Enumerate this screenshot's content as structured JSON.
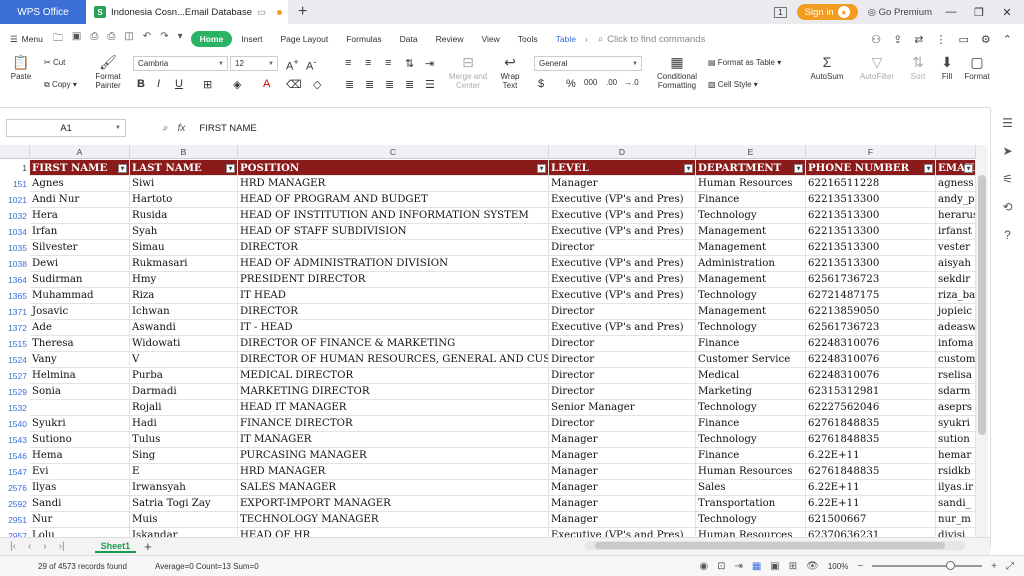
{
  "titlebar": {
    "app": "WPS Office",
    "doc_tab": "Indonesia Cosn...Email Database",
    "signin": "Sign in",
    "premium": "Go Premium",
    "page_counter": "1"
  },
  "menu": {
    "menu_label": "Menu",
    "tabs": [
      "Home",
      "Insert",
      "Page Layout",
      "Formulas",
      "Data",
      "Review",
      "View",
      "Tools",
      "Table"
    ],
    "search_placeholder": "Click to find commands"
  },
  "ribbon": {
    "paste": "Paste",
    "cut": "Cut",
    "copy": "Copy",
    "format_painter_1": "Format",
    "format_painter_2": "Painter",
    "font": "Cambria",
    "size": "12",
    "merge_1": "Merge and",
    "merge_2": "Center",
    "wrap_1": "Wrap",
    "wrap_2": "Text",
    "number_format": "General",
    "cond_1": "Conditional",
    "cond_2": "Formatting",
    "format_as_table": "Format as Table",
    "cell_style": "Cell Style",
    "autosum": "AutoSum",
    "autofilter": "AutoFilter",
    "sort": "Sort",
    "fill": "Fill",
    "format": "Format"
  },
  "formula": {
    "name_box": "A1",
    "value": "FIRST NAME"
  },
  "columns": [
    "A",
    "B",
    "C",
    "D",
    "E",
    "F",
    ""
  ],
  "header_row": {
    "num": "1",
    "cells": [
      "FIRST NAME",
      "LAST NAME",
      "POSITION",
      "LEVEL",
      "DEPARTMENT",
      "PHONE NUMBER",
      "EMAIL"
    ]
  },
  "rows": [
    {
      "num": "151",
      "cells": [
        "Agnes",
        "Siwi",
        "HRD MANAGER",
        "Manager",
        "Human Resources",
        "62216511228",
        "agness"
      ]
    },
    {
      "num": "1021",
      "cells": [
        "Andi Nur",
        "Hartoto",
        "HEAD OF PROGRAM AND BUDGET",
        "Executive (VP's and Pres)",
        "Finance",
        "62213513300",
        "andy_p"
      ]
    },
    {
      "num": "1032",
      "cells": [
        "Hera",
        "Rusida",
        "HEAD OF INSTITUTION AND INFORMATION SYSTEM",
        "Executive (VP's and Pres)",
        "Technology",
        "62213513300",
        "herarus"
      ]
    },
    {
      "num": "1034",
      "cells": [
        "Irfan",
        "Syah",
        "HEAD OF STAFF SUBDIVISION",
        "Executive (VP's and Pres)",
        "Management",
        "62213513300",
        "irfanst"
      ]
    },
    {
      "num": "1035",
      "cells": [
        "Silvester",
        "Simau",
        "DIRECTOR",
        "Director",
        "Management",
        "62213513300",
        "vester"
      ]
    },
    {
      "num": "1038",
      "cells": [
        "Dewi",
        "Rukmasari",
        "HEAD OF ADMINISTRATION DIVISION",
        "Executive (VP's and Pres)",
        "Administration",
        "62213513300",
        "aisyah"
      ]
    },
    {
      "num": "1364",
      "cells": [
        "Sudirman",
        "Hmy",
        "PRESIDENT DIRECTOR",
        "Executive (VP's and Pres)",
        "Management",
        "62561736723",
        "sekdir"
      ]
    },
    {
      "num": "1365",
      "cells": [
        "Muhammad",
        "Riza",
        "IT HEAD",
        "Executive (VP's and Pres)",
        "Technology",
        "62721487175",
        "riza_ba"
      ]
    },
    {
      "num": "1371",
      "cells": [
        "Josavic",
        "Ichwan",
        "DIRECTOR",
        "Director",
        "Management",
        "62213859050",
        "jopieic"
      ]
    },
    {
      "num": "1372",
      "cells": [
        "Ade",
        "Aswandi",
        "IT - HEAD",
        "Executive (VP's and Pres)",
        "Technology",
        "62561736723",
        "adeasw"
      ]
    },
    {
      "num": "1515",
      "cells": [
        "Theresa",
        "Widowati",
        "DIRECTOR OF FINANCE & MARKETING",
        "Director",
        "Finance",
        "62248310076",
        "infoma"
      ]
    },
    {
      "num": "1524",
      "cells": [
        "Vany",
        "V",
        "DIRECTOR OF HUMAN RESOURCES, GENERAL AND CUSTOMER SERVICE",
        "Director",
        "Customer Service",
        "62248310076",
        "custom"
      ]
    },
    {
      "num": "1527",
      "cells": [
        "Helmina",
        "Purba",
        "MEDICAL DIRECTOR",
        "Director",
        "Medical",
        "62248310076",
        "rselisa"
      ]
    },
    {
      "num": "1529",
      "cells": [
        "Sonia",
        "Darmadi",
        "MARKETING DIRECTOR",
        "Director",
        "Marketing",
        "62315312981",
        "sdarm"
      ]
    },
    {
      "num": "1532",
      "cells": [
        "",
        "Rojali",
        "HEAD IT MANAGER",
        "Senior Manager",
        "Technology",
        "62227562046",
        "aseprs"
      ]
    },
    {
      "num": "1540",
      "cells": [
        "Syukri",
        "Hadi",
        "FINANCE DIRECTOR",
        "Director",
        "Finance",
        "62761848835",
        "syukri"
      ]
    },
    {
      "num": "1543",
      "cells": [
        "Sutiono",
        "Tulus",
        "IT MANAGER",
        "Manager",
        "Technology",
        "62761848835",
        "sution"
      ]
    },
    {
      "num": "1546",
      "cells": [
        "Hema",
        "Sing",
        "PURCASING MANAGER",
        "Manager",
        "Finance",
        "6.22E+11",
        "hemar"
      ]
    },
    {
      "num": "1547",
      "cells": [
        "Evi",
        "E",
        "HRD MANAGER",
        "Manager",
        "Human Resources",
        "62761848835",
        "rsidkb"
      ]
    },
    {
      "num": "2576",
      "cells": [
        "Ilyas",
        "Irwansyah",
        "SALES MANAGER",
        "Manager",
        "Sales",
        "6.22E+11",
        "ilyas.ir"
      ]
    },
    {
      "num": "2592",
      "cells": [
        "Sandi",
        "Satria Togi Zay",
        "EXPORT-IMPORT MANAGER",
        "Manager",
        "Transportation",
        "6.22E+11",
        "sandi_"
      ]
    },
    {
      "num": "2951",
      "cells": [
        "Nur",
        "Muis",
        "TECHNOLOGY MANAGER",
        "Manager",
        "Technology",
        "621500667",
        "nur_m"
      ]
    },
    {
      "num": "2957",
      "cells": [
        "Lolu",
        "Iskandar",
        "HEAD OF HR",
        "Executive (VP's and Pres)",
        "Human Resources",
        "62370636231",
        "divisi"
      ]
    }
  ],
  "sheet": {
    "tab": "Sheet1"
  },
  "status": {
    "records": "29 of 4573 records found",
    "stats": "Average=0  Count=13  Sum=0",
    "zoom": "100%"
  }
}
